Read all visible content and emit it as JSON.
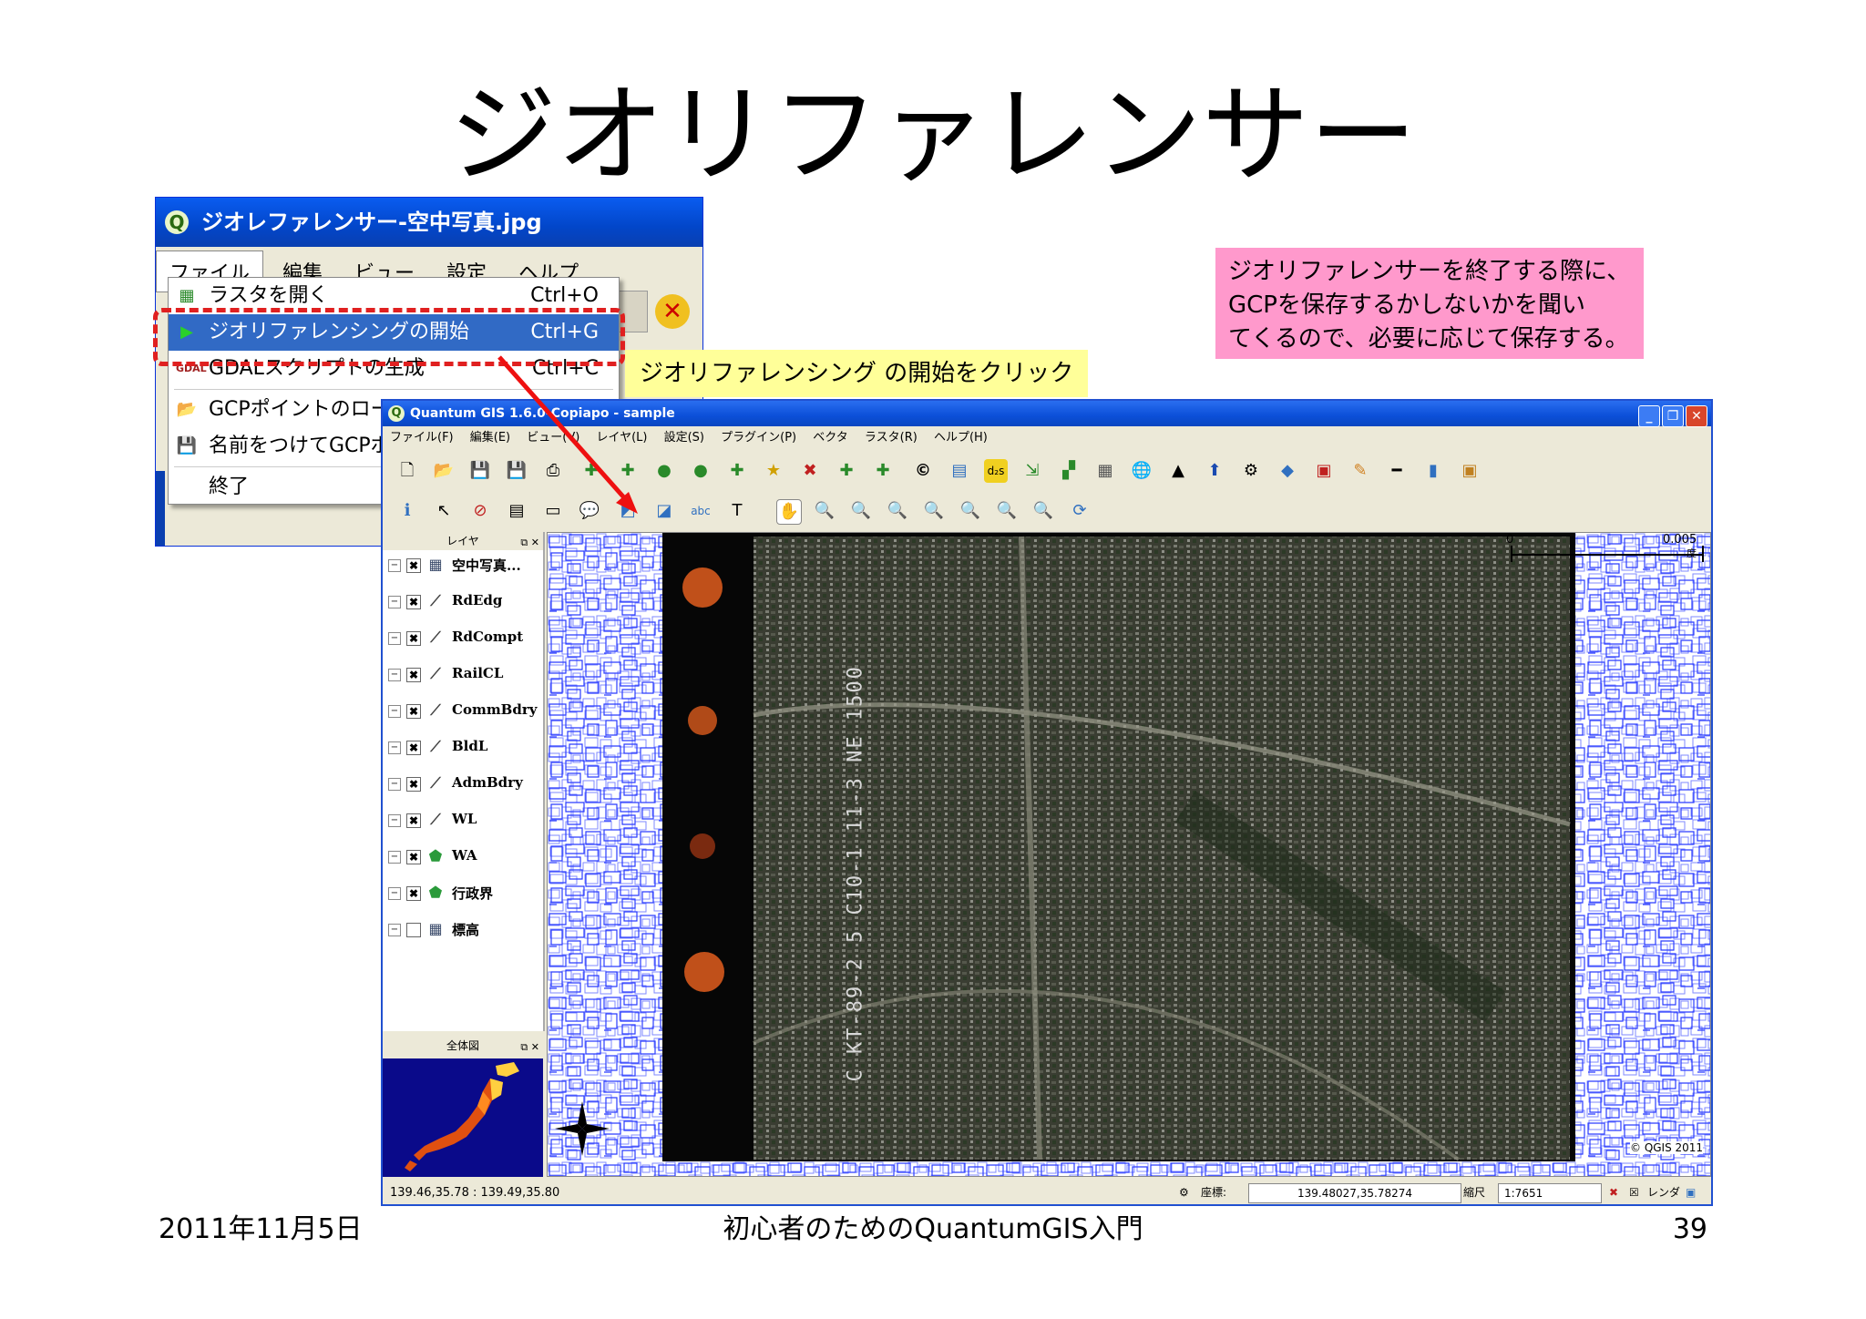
{
  "slide": {
    "title": "ジオリファレンサー",
    "footer_date": "2011年11月5日",
    "footer_course": "初心者のためのQuantumGIS入門",
    "page_number": "39"
  },
  "georeferencer": {
    "window_title": "ジオレファレンサー-空中写真.jpg",
    "menu": [
      "ファイル",
      "編集",
      "ビュー",
      "設定",
      "ヘルプ"
    ],
    "file_menu": [
      {
        "label": "ラスタを開く",
        "shortcut": "Ctrl+O",
        "icon": "open-raster-icon"
      },
      {
        "label": "ジオリファレンシングの開始",
        "shortcut": "Ctrl+G",
        "icon": "play-icon"
      },
      {
        "label": "GDALスクリプトの生成",
        "shortcut": "Ctrl+C",
        "icon": "gdal-icon"
      },
      {
        "label": "GCPポイントのロード",
        "shortcut": "",
        "icon": "load-gcp-icon"
      },
      {
        "label": "名前をつけてGCPポイ",
        "shortcut": "",
        "icon": "save-gcp-icon"
      },
      {
        "label": "終了",
        "shortcut": "",
        "icon": ""
      }
    ]
  },
  "callouts": {
    "start_click": "ジオリファレンシング の開始をクリック",
    "note_lines": [
      "ジオリファレンサーを終了する際に、",
      "GCPを保存するかしないかを聞い",
      "てくるので、必要に応じて保存する。"
    ]
  },
  "qgis": {
    "window_title": "Quantum GIS 1.6.0-Copiapo - sample",
    "menu": [
      "ファイル(F)",
      "編集(E)",
      "ビュー(V)",
      "レイヤ(L)",
      "設定(S)",
      "プラグイン(P)",
      "ベクタ",
      "ラスタ(R)",
      "ヘルプ(H)"
    ],
    "layers_panel_title": "レイヤ",
    "layers": [
      {
        "name": "空中写真...",
        "checked": true,
        "icon": "raster-icon"
      },
      {
        "name": "RdEdg",
        "checked": true,
        "icon": "line-icon"
      },
      {
        "name": "RdCompt",
        "checked": true,
        "icon": "line-icon"
      },
      {
        "name": "RailCL",
        "checked": true,
        "icon": "line-icon"
      },
      {
        "name": "CommBdry",
        "checked": true,
        "icon": "line-icon"
      },
      {
        "name": "BldL",
        "checked": true,
        "icon": "line-icon"
      },
      {
        "name": "AdmBdry",
        "checked": true,
        "icon": "line-icon"
      },
      {
        "name": "WL",
        "checked": true,
        "icon": "line-icon"
      },
      {
        "name": "WA",
        "checked": true,
        "icon": "polygon-icon"
      },
      {
        "name": "行政界",
        "checked": true,
        "icon": "polygon-icon"
      },
      {
        "name": "標高",
        "checked": false,
        "icon": "raster-icon"
      }
    ],
    "overview_title": "全体図",
    "scalebar_left": "0",
    "scalebar_right": "0.005",
    "scalebar_unit": "度",
    "copyright": "© QGIS 2011",
    "film_text": "C KT-89-2 5 C10-1 11-3 NE 1500",
    "status": {
      "coord_range": "139.46,35.78 : 139.49,35.80",
      "coord_label": "座標:",
      "coord_value": "139.48027,35.78274",
      "scale_label": "縮尺",
      "scale_value": "1:7651",
      "render_label": "レンダ"
    }
  },
  "colors": {
    "xp_blue": "#0a46c0",
    "highlight": "#316ac5",
    "dash_red": "#e02020",
    "yellow_callout": "#ffff99",
    "pink_callout": "#ff99cc",
    "vector_blue": "#2a3cff"
  }
}
